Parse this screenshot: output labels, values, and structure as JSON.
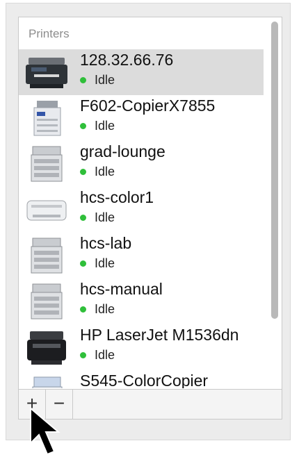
{
  "printers_panel": {
    "header": "Printers",
    "printers": [
      {
        "name": "128.32.66.76",
        "status": "Idle",
        "icon": "multifunction-printer-icon",
        "selected": true
      },
      {
        "name": "F602-CopierX7855",
        "status": "Idle",
        "icon": "copier-icon",
        "selected": false
      },
      {
        "name": "grad-lounge",
        "status": "Idle",
        "icon": "office-printer-icon",
        "selected": false
      },
      {
        "name": "hcs-color1",
        "status": "Idle",
        "icon": "laser-printer-icon",
        "selected": false
      },
      {
        "name": "hcs-lab",
        "status": "Idle",
        "icon": "office-printer-icon",
        "selected": false
      },
      {
        "name": "hcs-manual",
        "status": "Idle",
        "icon": "office-printer-icon",
        "selected": false
      },
      {
        "name": "HP LaserJet M1536dn",
        "status": "Idle",
        "icon": "mfp-black-printer-icon",
        "selected": false
      },
      {
        "name": "S545-ColorCopier",
        "status": "",
        "icon": "color-copier-icon",
        "selected": false
      }
    ],
    "toolbar": {
      "add_label": "+",
      "remove_label": "−"
    },
    "status_color": "#2fbf3a",
    "selection_color": "#dcdcdc"
  }
}
